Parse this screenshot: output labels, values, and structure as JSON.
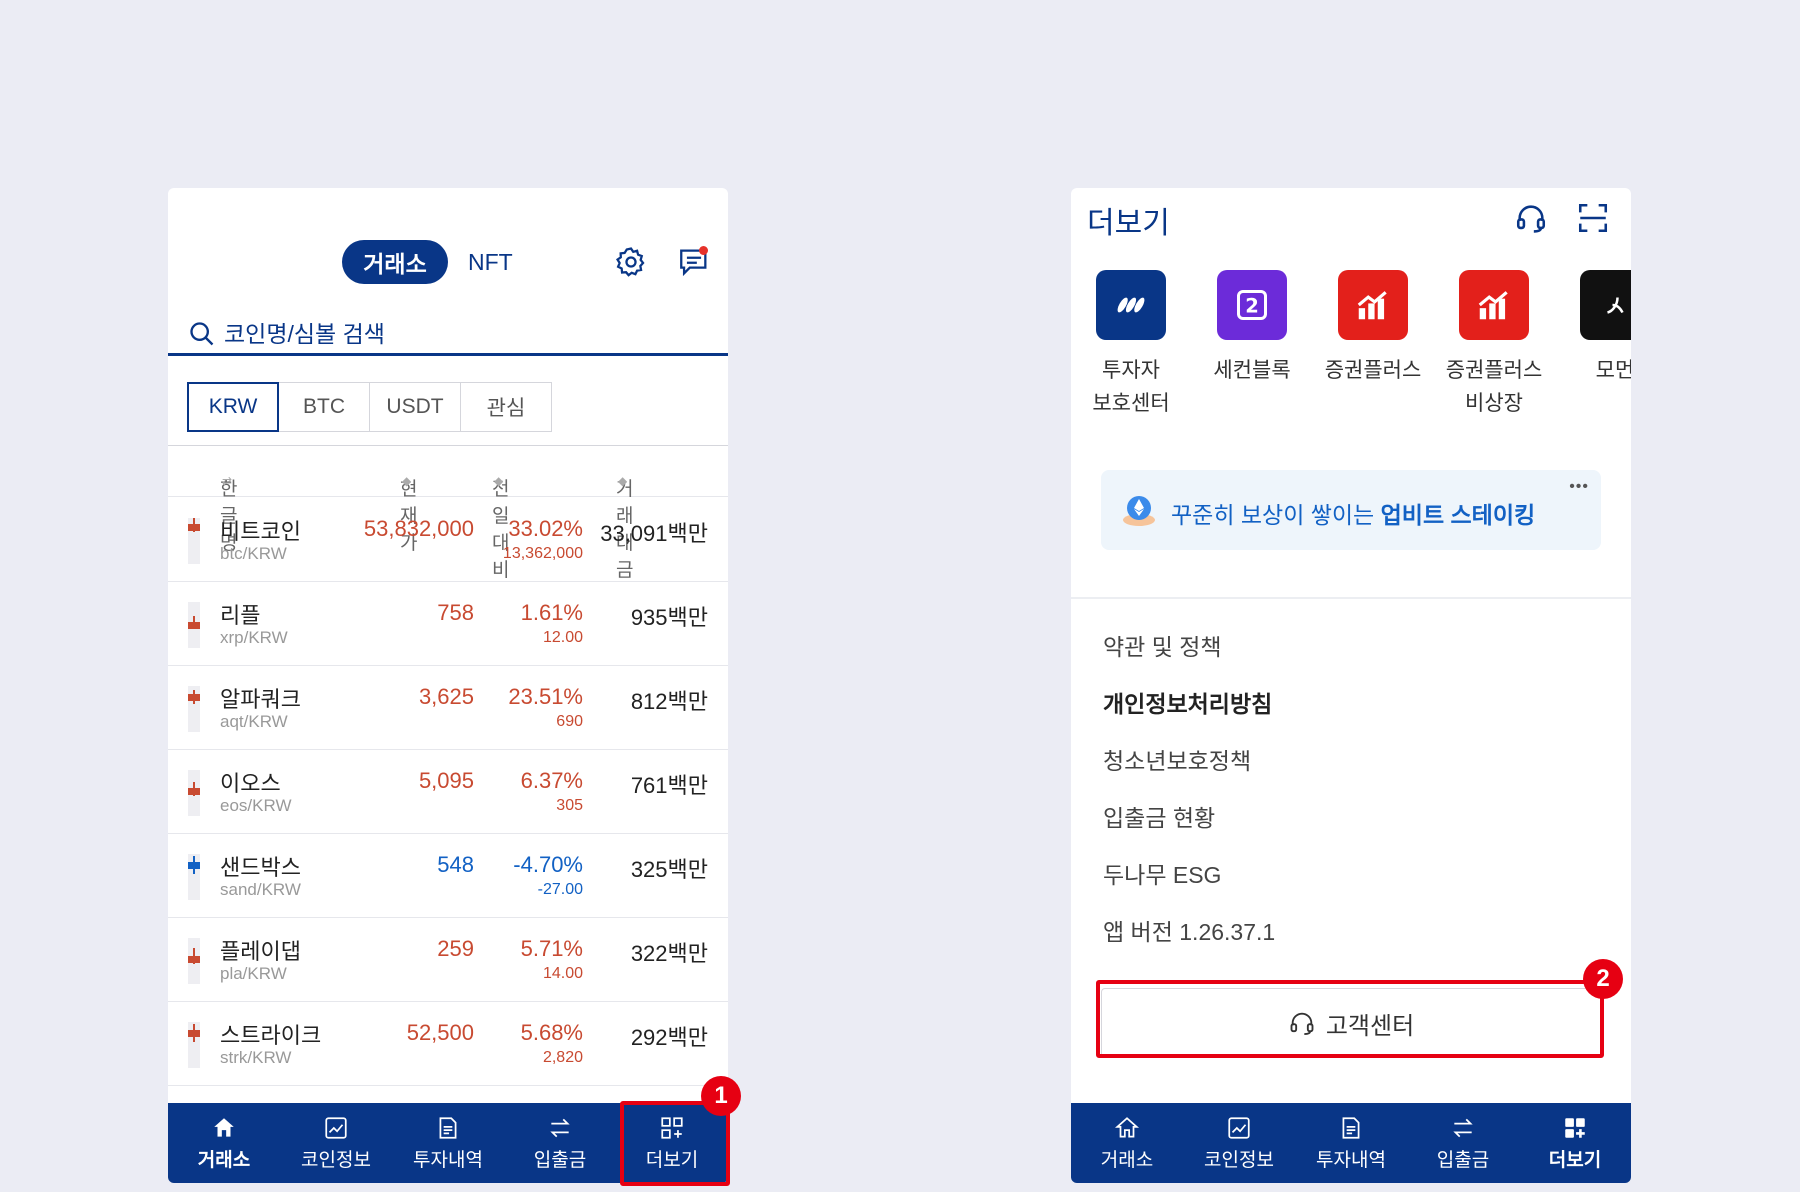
{
  "left_screen": {
    "top_tabs": {
      "exchange": "거래소",
      "nft": "NFT"
    },
    "icons": {
      "settings": "gear-icon",
      "chat": "chat-icon"
    },
    "search": {
      "placeholder": "코인명/심볼 검색"
    },
    "market_tabs": [
      "KRW",
      "BTC",
      "USDT",
      "관심"
    ],
    "columns": {
      "name": "한글명",
      "price": "현재가",
      "change": "전일대비",
      "volume": "거래대금"
    },
    "coins": [
      {
        "name": "비트코인",
        "symbol": "btc/KRW",
        "price": "53,832,000",
        "pct": "33.02%",
        "diff": "13,362,000",
        "volume": "33,091백만",
        "trend": "up"
      },
      {
        "name": "리플",
        "symbol": "xrp/KRW",
        "price": "758",
        "pct": "1.61%",
        "diff": "12.00",
        "volume": "935백만",
        "trend": "up"
      },
      {
        "name": "알파쿼크",
        "symbol": "aqt/KRW",
        "price": "3,625",
        "pct": "23.51%",
        "diff": "690",
        "volume": "812백만",
        "trend": "up"
      },
      {
        "name": "이오스",
        "symbol": "eos/KRW",
        "price": "5,095",
        "pct": "6.37%",
        "diff": "305",
        "volume": "761백만",
        "trend": "up"
      },
      {
        "name": "샌드박스",
        "symbol": "sand/KRW",
        "price": "548",
        "pct": "-4.70%",
        "diff": "-27.00",
        "volume": "325백만",
        "trend": "down"
      },
      {
        "name": "플레이댑",
        "symbol": "pla/KRW",
        "price": "259",
        "pct": "5.71%",
        "diff": "14.00",
        "volume": "322백만",
        "trend": "up"
      },
      {
        "name": "스트라이크",
        "symbol": "strk/KRW",
        "price": "52,500",
        "pct": "5.68%",
        "diff": "2,820",
        "volume": "292백만",
        "trend": "up"
      }
    ],
    "nav": [
      "거래소",
      "코인정보",
      "투자내역",
      "입출금",
      "더보기"
    ],
    "step_badge": "1"
  },
  "right_screen": {
    "title": "더보기",
    "icons": {
      "headset": "headset-icon",
      "scan": "scan-icon"
    },
    "apps": [
      {
        "label": "투자자\n보호센터",
        "color": "#093687",
        "icon": "investor-protection-icon"
      },
      {
        "label": "세컨블록",
        "color": "#6c2bd9",
        "icon": "secondblock-icon"
      },
      {
        "label": "증권플러스",
        "color": "#e3201b",
        "icon": "stock-plus-icon"
      },
      {
        "label": "증권플러스\n비상장",
        "color": "#e3201b",
        "icon": "stock-plus-unlisted-icon"
      },
      {
        "label": "모먼",
        "color": "#111111",
        "icon": "moment-icon"
      }
    ],
    "banner": {
      "prefix": "꾸준히 보상이 쌓이는 ",
      "highlight": "업비트 스테이킹"
    },
    "menu": [
      "약관 및 정책",
      "개인정보처리방침",
      "청소년보호정책",
      "입출금 현황",
      "두나무 ESG",
      "앱 버전 1.26.37.1"
    ],
    "support_button": "고객센터",
    "nav": [
      "거래소",
      "코인정보",
      "투자내역",
      "입출금",
      "더보기"
    ],
    "step_badge": "2"
  },
  "colors": {
    "brand": "#093687",
    "up": "#c84a31",
    "down": "#1261c4",
    "highlight": "#e60012"
  }
}
